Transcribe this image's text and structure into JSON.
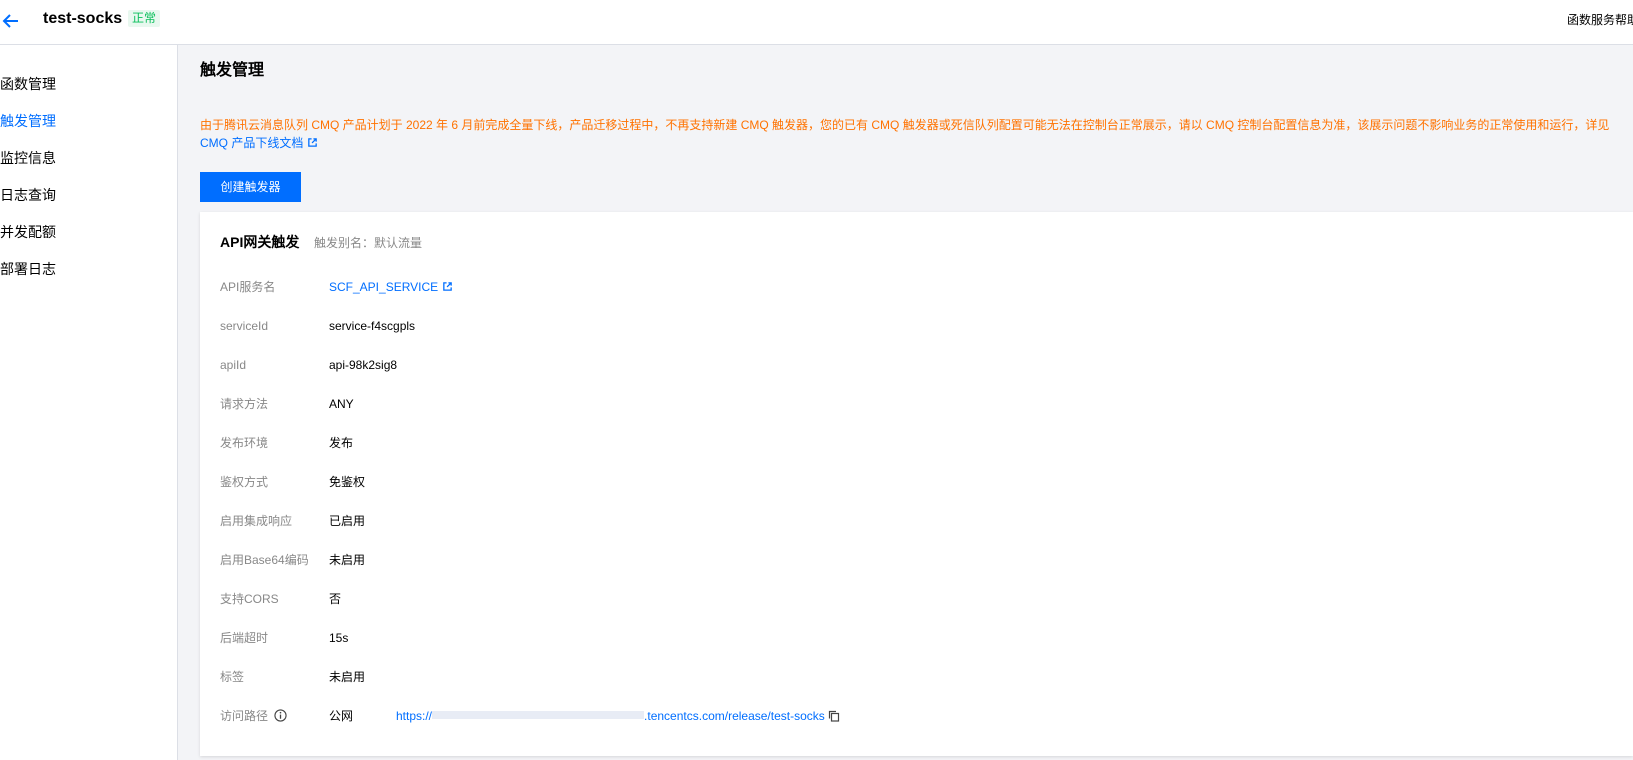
{
  "header": {
    "title": "test-socks",
    "status": "正常",
    "help_link": "函数服务帮助"
  },
  "sidebar": {
    "items": [
      {
        "label": "函数管理",
        "active": false
      },
      {
        "label": "触发管理",
        "active": true
      },
      {
        "label": "监控信息",
        "active": false
      },
      {
        "label": "日志查询",
        "active": false
      },
      {
        "label": "并发配额",
        "active": false
      },
      {
        "label": "部署日志",
        "active": false
      }
    ]
  },
  "main": {
    "page_title": "触发管理",
    "notice_text": "由于腾讯云消息队列 CMQ 产品计划于 2022 年 6 月前完成全量下线，产品迁移过程中，不再支持新建 CMQ 触发器，您的已有 CMQ 触发器或死信队列配置可能无法在控制台正常展示，请以 CMQ 控制台配置信息为准，该展示问题不影响业务的正常使用和运行，详见",
    "notice_link": "CMQ 产品下线文档",
    "create_button": "创建触发器",
    "trigger": {
      "type": "API网关触发",
      "alias": "触发别名：默认流量",
      "rows": [
        {
          "label": "API服务名",
          "value": "SCF_API_SERVICE"
        },
        {
          "label": "serviceId",
          "value": "service-f4scgpls"
        },
        {
          "label": "apiId",
          "value": "api-98k2sig8"
        },
        {
          "label": "请求方法",
          "value": "ANY"
        },
        {
          "label": "发布环境",
          "value": "发布"
        },
        {
          "label": "鉴权方式",
          "value": "免鉴权"
        },
        {
          "label": "启用集成响应",
          "value": "已启用"
        },
        {
          "label": "启用Base64编码",
          "value": "未启用"
        },
        {
          "label": "支持CORS",
          "value": "否"
        },
        {
          "label": "后端超时",
          "value": "15s"
        },
        {
          "label": "标签",
          "value": "未启用"
        }
      ],
      "access_path": {
        "label": "访问路径",
        "network": "公网",
        "url_prefix": "https://",
        "url_suffix": ".tencentcs.com/release/test-socks"
      }
    }
  },
  "colors": {
    "primary": "#006eff",
    "warning": "#ff7200",
    "success": "#0abf5b"
  }
}
